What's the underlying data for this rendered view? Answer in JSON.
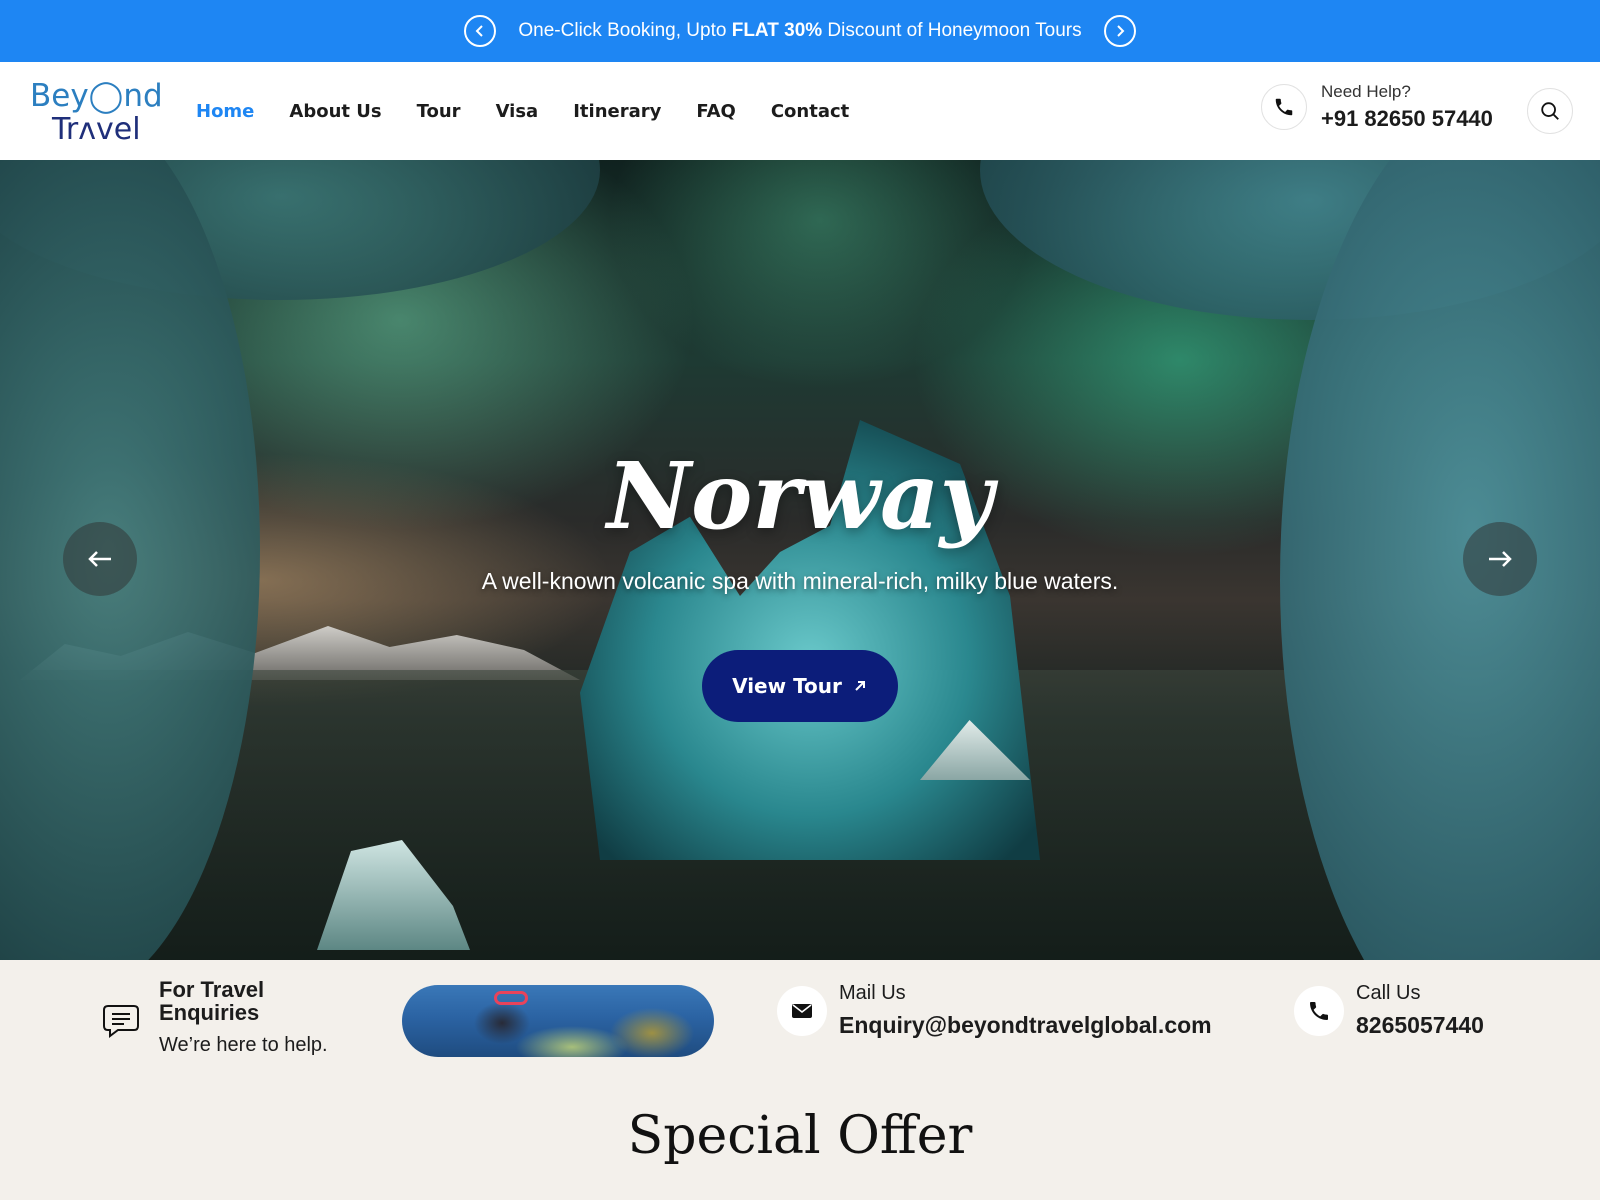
{
  "promo": {
    "text_prefix": "One-Click Booking, Upto ",
    "text_bold": "FLAT 30%",
    "text_suffix": " Discount of Honeymoon Tours"
  },
  "header": {
    "logo_line1": "Bey◯nd",
    "logo_line2": "Trʌvel",
    "nav": [
      "Home",
      "About Us",
      "Tour",
      "Visa",
      "Itinerary",
      "FAQ",
      "Contact"
    ],
    "active_nav": "Home",
    "help_label": "Need Help?",
    "help_phone": "+91 82650 57440"
  },
  "hero": {
    "title": "Norway",
    "subtitle": "A well-known volcanic spa with mineral-rich, milky blue waters.",
    "cta_label": "View Tour"
  },
  "info": {
    "enquiry_title": "For Travel Enquiries",
    "enquiry_sub": "We’re here to help.",
    "mail_label": "Mail Us",
    "mail_value": "Enquiry@beyondtravelglobal.com",
    "call_label": "Call Us",
    "call_value": "8265057440"
  },
  "section": {
    "title": "Special Offer"
  },
  "colors": {
    "promo_bg": "#1e86f3",
    "nav_active": "#1e86f3",
    "cta_bg": "#0c1d7a"
  },
  "icons": [
    "chevron-left-icon",
    "chevron-right-icon",
    "phone-icon",
    "search-icon",
    "arrow-left-icon",
    "arrow-right-icon",
    "arrow-up-right-icon",
    "chat-icon",
    "mail-icon"
  ]
}
